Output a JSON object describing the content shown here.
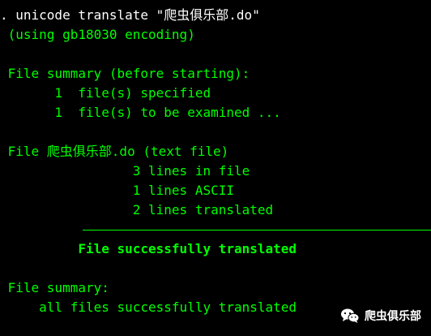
{
  "colors": {
    "background": "#000000",
    "output_text": "#00ff00",
    "command_text": "#ffffff"
  },
  "console": {
    "command": ". unicode translate \"爬虫俱乐部.do\"",
    "encoding_note": " (using gb18030 encoding)",
    "summary_before_heading": " File summary (before starting):",
    "files_specified": "       1  file(s) specified",
    "files_examined": "       1  file(s) to be examined ...",
    "file_heading": " File 爬虫俱乐部.do (text file)",
    "lines_in_file": "                 3 lines in file",
    "lines_ascii": "                 1 lines ASCII",
    "lines_translated": "                 2 lines translated",
    "success_message": "          File successfully translated",
    "summary_heading": " File summary:",
    "all_translated": "     all files successfully translated"
  },
  "watermark": {
    "icon": "wechat-icon",
    "label": "爬虫俱乐部"
  }
}
